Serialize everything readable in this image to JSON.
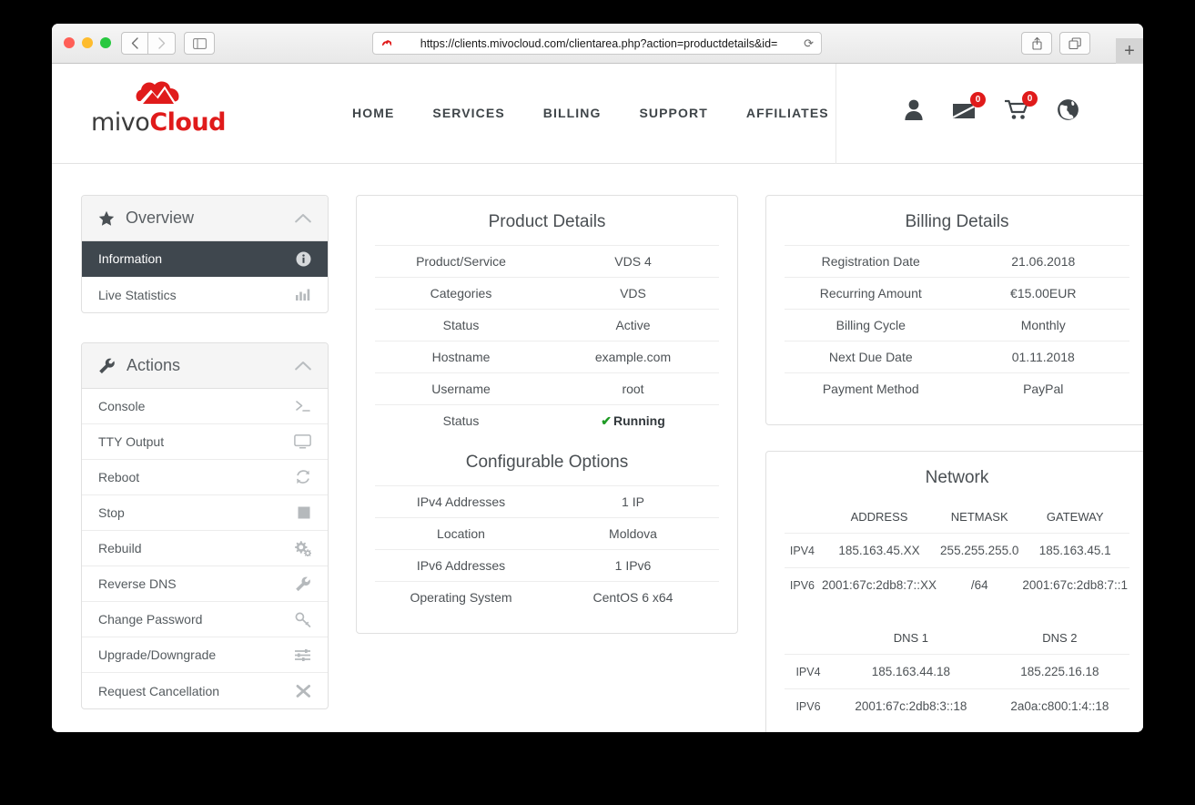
{
  "browser": {
    "url": "https://clients.mivocloud.com/clientarea.php?action=productdetails&id=",
    "back_label": "‹",
    "forward_label": "›",
    "reload_label": "⟳",
    "new_tab_label": "+"
  },
  "site_header": {
    "logo_primary": "mivo",
    "logo_accent": "Cloud",
    "nav": [
      {
        "label": "HOME"
      },
      {
        "label": "SERVICES"
      },
      {
        "label": "BILLING"
      },
      {
        "label": "SUPPORT"
      },
      {
        "label": "AFFILIATES"
      }
    ],
    "icons": {
      "mail_badge": "0",
      "cart_badge": "0"
    }
  },
  "sidebar": {
    "panels": [
      {
        "title": "Overview",
        "items": [
          {
            "label": "Information",
            "active": true
          },
          {
            "label": "Live Statistics",
            "active": false
          }
        ]
      },
      {
        "title": "Actions",
        "items": [
          {
            "label": "Console"
          },
          {
            "label": "TTY Output"
          },
          {
            "label": "Reboot"
          },
          {
            "label": "Stop"
          },
          {
            "label": "Rebuild"
          },
          {
            "label": "Reverse DNS"
          },
          {
            "label": "Change Password"
          },
          {
            "label": "Upgrade/Downgrade"
          },
          {
            "label": "Request Cancellation"
          }
        ]
      }
    ]
  },
  "product_details": {
    "title": "Product Details",
    "rows": [
      {
        "key": "Product/Service",
        "value": "VDS 4"
      },
      {
        "key": "Categories",
        "value": "VDS"
      },
      {
        "key": "Status",
        "value": "Active"
      },
      {
        "key": "Hostname",
        "value": "example.com"
      },
      {
        "key": "Username",
        "value": "root"
      },
      {
        "key": "Status",
        "value": "Running",
        "bold": true,
        "check": true
      }
    ]
  },
  "configurable_options": {
    "title": "Configurable Options",
    "rows": [
      {
        "key": "IPv4 Addresses",
        "value": "1 IP"
      },
      {
        "key": "Location",
        "value": "Moldova"
      },
      {
        "key": "IPv6 Addresses",
        "value": "1 IPv6"
      },
      {
        "key": "Operating System",
        "value": "CentOS 6 x64"
      }
    ]
  },
  "billing_details": {
    "title": "Billing Details",
    "rows": [
      {
        "key": "Registration Date",
        "value": "21.06.2018"
      },
      {
        "key": "Recurring Amount",
        "value": "€15.00EUR"
      },
      {
        "key": "Billing Cycle",
        "value": "Monthly"
      },
      {
        "key": "Next Due Date",
        "value": "01.11.2018"
      },
      {
        "key": "Payment Method",
        "value": "PayPal"
      }
    ]
  },
  "network": {
    "title": "Network",
    "address_headers": [
      "",
      "ADDRESS",
      "NETMASK",
      "GATEWAY"
    ],
    "address_rows": [
      [
        "IPV4",
        "185.163.45.XX",
        "255.255.255.0",
        "185.163.45.1"
      ],
      [
        "IPV6",
        "2001:67c:2db8:7::XX",
        "/64",
        "2001:67c:2db8:7::1"
      ]
    ],
    "dns_headers": [
      "",
      "DNS 1",
      "DNS 2"
    ],
    "dns_rows": [
      [
        "IPV4",
        "185.163.44.18",
        "185.225.16.18"
      ],
      [
        "IPV6",
        "2001:67c:2db8:3::18",
        "2a0a:c800:1:4::18"
      ]
    ]
  },
  "colors": {
    "accent_red": "#e01b1b",
    "active_dark": "#3f474e",
    "status_green": "#1f9b25"
  }
}
